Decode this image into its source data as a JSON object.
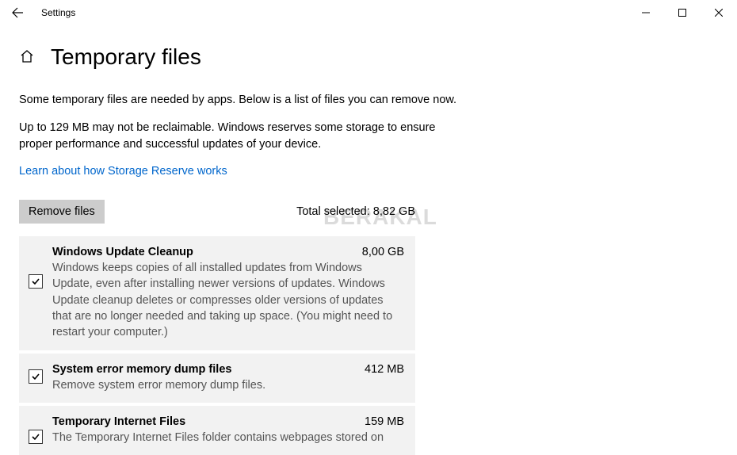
{
  "window": {
    "title": "Settings"
  },
  "page": {
    "title": "Temporary files",
    "intro1": "Some temporary files are needed by apps. Below is a list of files you can remove now.",
    "intro2": "Up to 129 MB may not be reclaimable. Windows reserves some storage to ensure proper performance and successful updates of your device.",
    "link": "Learn about how Storage Reserve works",
    "remove_btn": "Remove files",
    "total_label": "Total selected: ",
    "total_value": "8,82 GB"
  },
  "items": [
    {
      "title": "Windows Update Cleanup",
      "size": "8,00 GB",
      "desc": "Windows keeps copies of all installed updates from Windows Update, even after installing newer versions of updates. Windows Update cleanup deletes or compresses older versions of updates that are no longer needed and taking up space. (You might need to restart your computer.)"
    },
    {
      "title": "System error memory dump files",
      "size": "412 MB",
      "desc": "Remove system error memory dump files."
    },
    {
      "title": "Temporary Internet Files",
      "size": "159 MB",
      "desc": "The Temporary Internet Files folder contains webpages stored on"
    }
  ],
  "watermark": "BERAKAL"
}
